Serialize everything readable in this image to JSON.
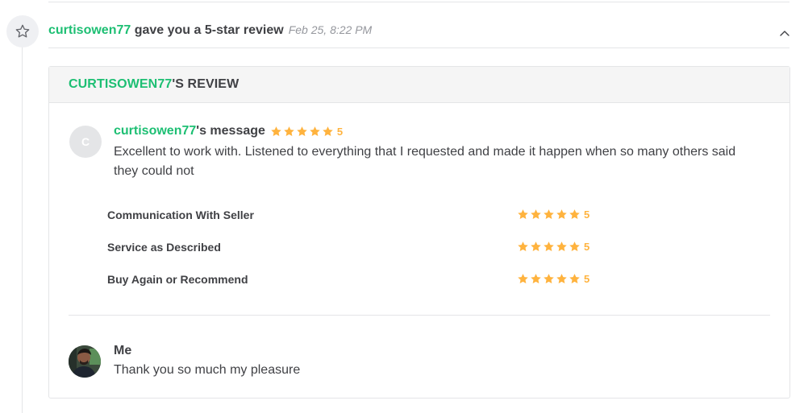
{
  "activity": {
    "username": "curtisowen77",
    "action_text": " gave you a 5-star review",
    "timestamp": "Feb 25, 8:22 PM",
    "icon": "star-outline-icon",
    "toggle_icon": "chevron-up-icon"
  },
  "review": {
    "header_username": "CURTISOWEN77",
    "header_suffix": "'S REVIEW",
    "buyer_initial": "C",
    "buyer_username": "curtisowen77",
    "message_suffix": "'s message",
    "overall_rating": "5",
    "message": "Excellent to work with. Listened to everything that I requested and made it happen when so many others said they could not",
    "criteria": [
      {
        "label": "Communication With Seller",
        "rating": "5"
      },
      {
        "label": "Service as Described",
        "rating": "5"
      },
      {
        "label": "Buy Again or Recommend",
        "rating": "5"
      }
    ]
  },
  "reply": {
    "name": "Me",
    "message": "Thank you so much my pleasure"
  },
  "colors": {
    "accent_green": "#1dbf73",
    "star_orange": "#ffb33e",
    "text_dark": "#404145",
    "muted": "#95979d"
  }
}
